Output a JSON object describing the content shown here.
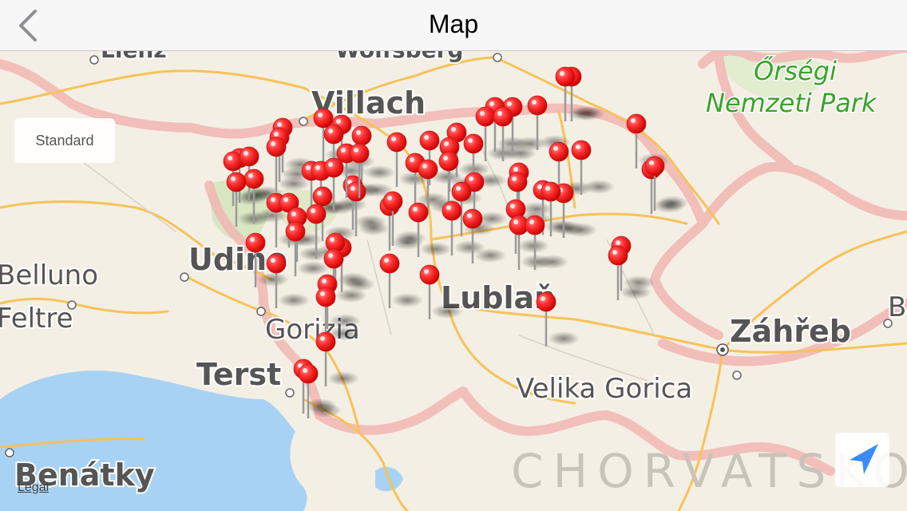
{
  "navbar": {
    "title": "Map",
    "back_icon": "chevron-left-icon"
  },
  "map_type_control": {
    "selected": "Standard"
  },
  "legal_link": "Legal",
  "locate_button": {
    "icon": "location-arrow-icon"
  },
  "colors": {
    "accent": "#3b8cf5",
    "pin": "#ff2d2d",
    "water": "#a8d2f3",
    "land": "#f4efe4",
    "border": "#f2b3b0",
    "road": "#f7c25a",
    "park_text": "#3aa32b"
  },
  "map_labels": {
    "lienz": "Lienz",
    "wolfsberg": "Wolfsberg",
    "villach": "Villach",
    "orsegi": "Őrségi",
    "nemzeti_park": "Nemzeti Park",
    "udine": "Udine",
    "belluno": "Belluno",
    "feltre": "Feltre",
    "gorizia": "Gorizia",
    "ljubljana": "Lublaň",
    "terst": "Terst",
    "zagreb": "Záhřeb",
    "velika_gorica": "Velika Gorica",
    "benatky": "Benátky",
    "chorvatsko": "CHORVATSKO",
    "b_edge": "B"
  }
}
